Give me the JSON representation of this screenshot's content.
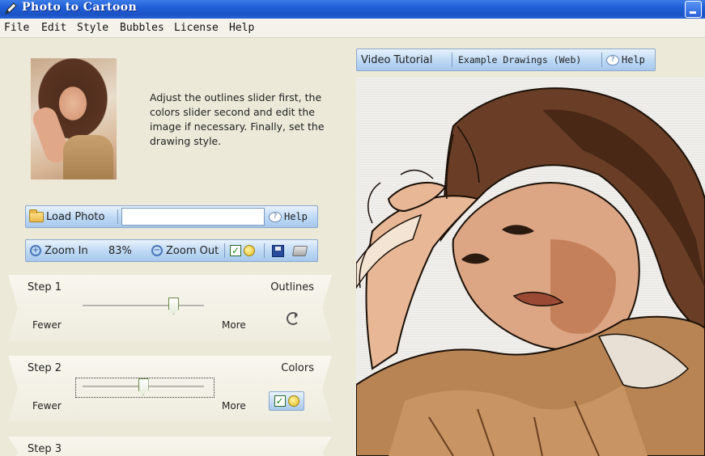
{
  "window": {
    "title": "Photo to Cartoon"
  },
  "menu": {
    "items": [
      "File",
      "Edit",
      "Style",
      "Bubbles",
      "License",
      "Help"
    ]
  },
  "instructions": "Adjust the outlines slider first, the colors slider second and edit the image if necessary. Finally, set the drawing style.",
  "load_bar": {
    "load_label": "Load Photo",
    "photo_path_value": "",
    "help_label": "Help"
  },
  "zoom_bar": {
    "zoom_in_label": "Zoom In",
    "zoom_level": "83%",
    "zoom_out_label": "Zoom Out"
  },
  "steps": [
    {
      "step_label": "Step 1",
      "name": "Outlines",
      "fewer": "Fewer",
      "more": "More",
      "slider_fraction": 0.75
    },
    {
      "step_label": "Step 2",
      "name": "Colors",
      "fewer": "Fewer",
      "more": "More",
      "slider_fraction": 0.5
    },
    {
      "step_label": "Step 3"
    }
  ],
  "right_toolbar": {
    "video_tutorial": "Video Tutorial",
    "example_drawings": "Example Drawings (Web)",
    "help": "Help"
  },
  "colors": {
    "titlebar": "#1f5ed6",
    "toolbar": "#bcd8f4",
    "background": "#ece9d8"
  }
}
